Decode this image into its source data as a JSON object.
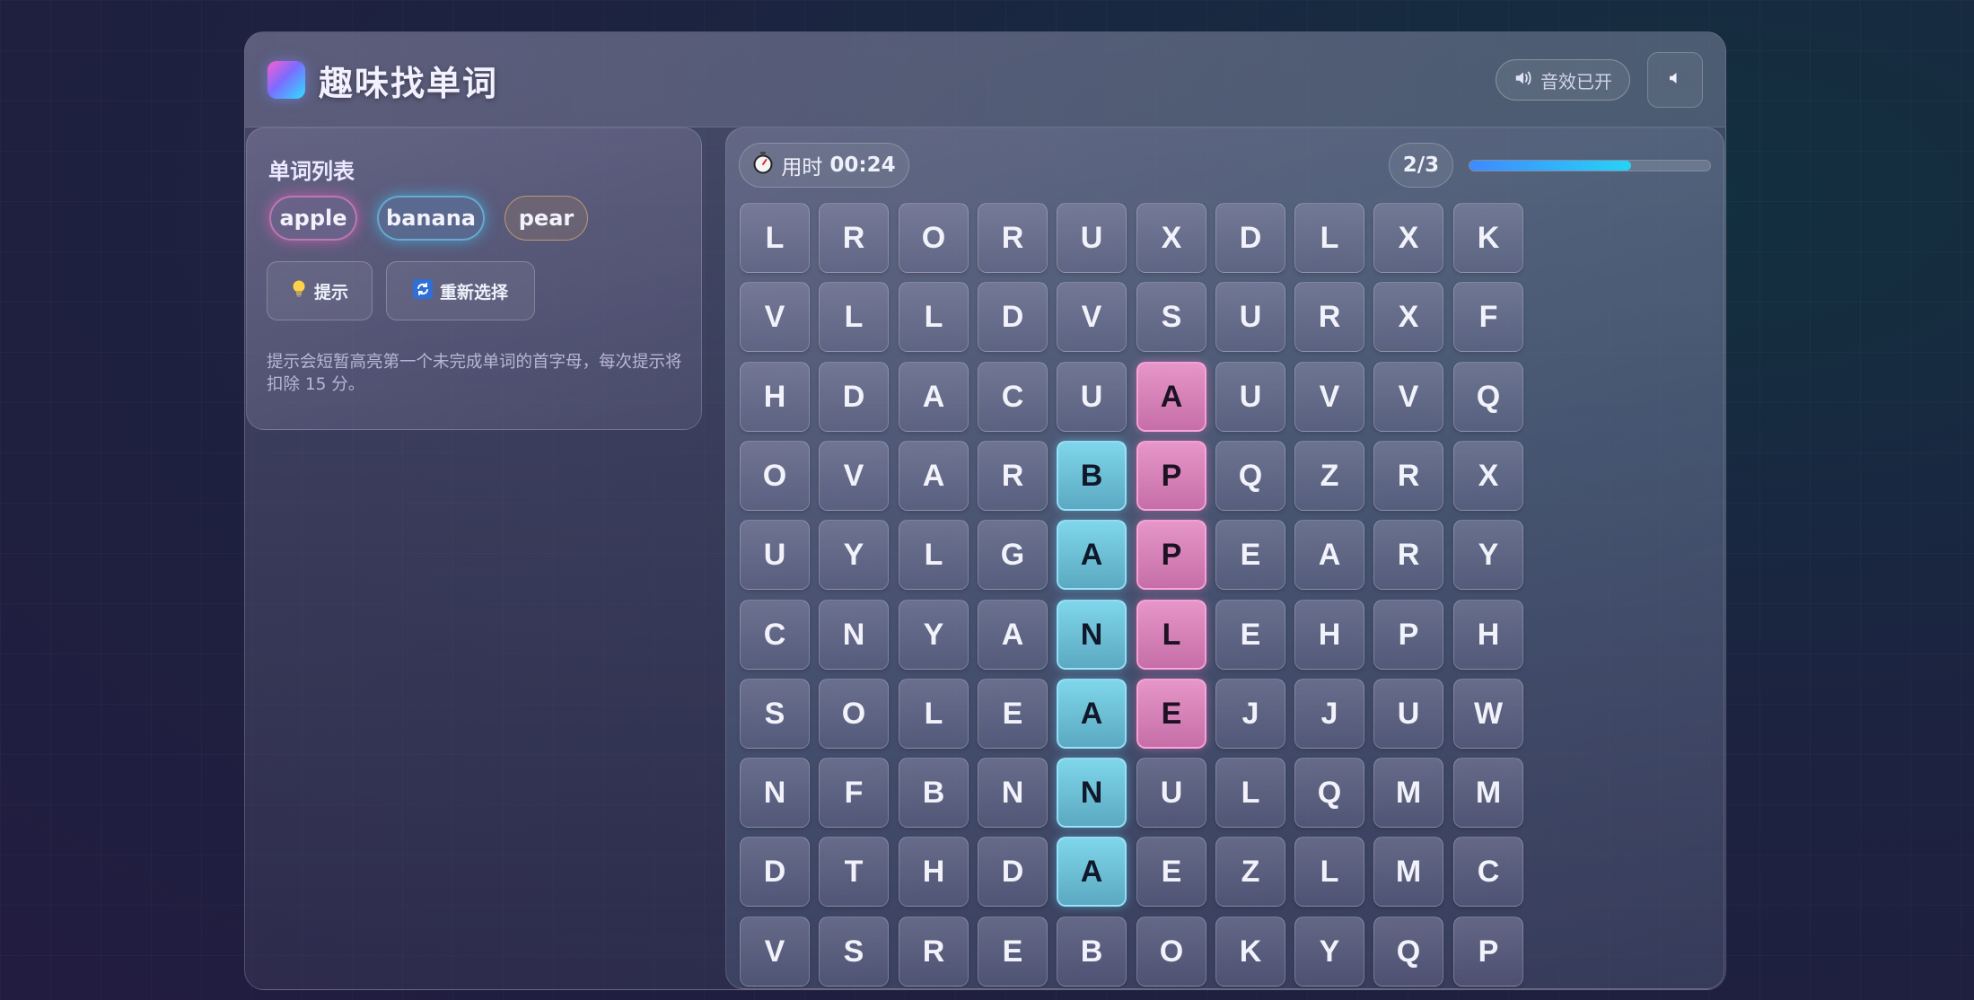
{
  "header": {
    "title": "趣味找单词",
    "sound_label": "音效已开"
  },
  "sidebar": {
    "title": "单词列表",
    "words": [
      {
        "label": "apple",
        "status": "found",
        "color": "#ff5cc8"
      },
      {
        "label": "banana",
        "status": "found",
        "color": "#3cc8ff"
      },
      {
        "label": "pear",
        "status": "pending",
        "color": "#f0be78"
      }
    ],
    "hint_label": "提示",
    "reset_label": "重新选择",
    "hint_text": "提示会短暂高亮第一个未完成单词的首字母，每次提示将扣除 15 分。"
  },
  "game": {
    "timer_label": "用时",
    "timer_value": "00:24",
    "progress_text": "2/3",
    "progress_fraction": 0.67,
    "grid": [
      [
        "L",
        "R",
        "O",
        "R",
        "U",
        "X",
        "D",
        "L",
        "X",
        "K"
      ],
      [
        "V",
        "L",
        "L",
        "D",
        "V",
        "S",
        "U",
        "R",
        "X",
        "F"
      ],
      [
        "H",
        "D",
        "A",
        "C",
        "U",
        "A",
        "U",
        "V",
        "V",
        "Q"
      ],
      [
        "O",
        "V",
        "A",
        "R",
        "B",
        "P",
        "Q",
        "Z",
        "R",
        "X"
      ],
      [
        "U",
        "Y",
        "L",
        "G",
        "A",
        "P",
        "E",
        "A",
        "R",
        "Y"
      ],
      [
        "C",
        "N",
        "Y",
        "A",
        "N",
        "L",
        "E",
        "H",
        "P",
        "H"
      ],
      [
        "S",
        "O",
        "L",
        "E",
        "A",
        "E",
        "J",
        "J",
        "U",
        "W"
      ],
      [
        "N",
        "F",
        "B",
        "N",
        "N",
        "U",
        "L",
        "Q",
        "M",
        "M"
      ],
      [
        "D",
        "T",
        "H",
        "D",
        "A",
        "E",
        "Z",
        "L",
        "M",
        "C"
      ],
      [
        "V",
        "S",
        "R",
        "E",
        "B",
        "O",
        "K",
        "Y",
        "Q",
        "P"
      ]
    ],
    "found_cells": [
      {
        "word": "banana",
        "color": "blue",
        "cells": [
          [
            3,
            4
          ],
          [
            4,
            4
          ],
          [
            5,
            4
          ],
          [
            6,
            4
          ],
          [
            7,
            4
          ],
          [
            8,
            4
          ]
        ]
      },
      {
        "word": "apple",
        "color": "pink",
        "cells": [
          [
            2,
            5
          ],
          [
            3,
            5
          ],
          [
            4,
            5
          ],
          [
            5,
            5
          ],
          [
            6,
            5
          ]
        ]
      }
    ]
  }
}
